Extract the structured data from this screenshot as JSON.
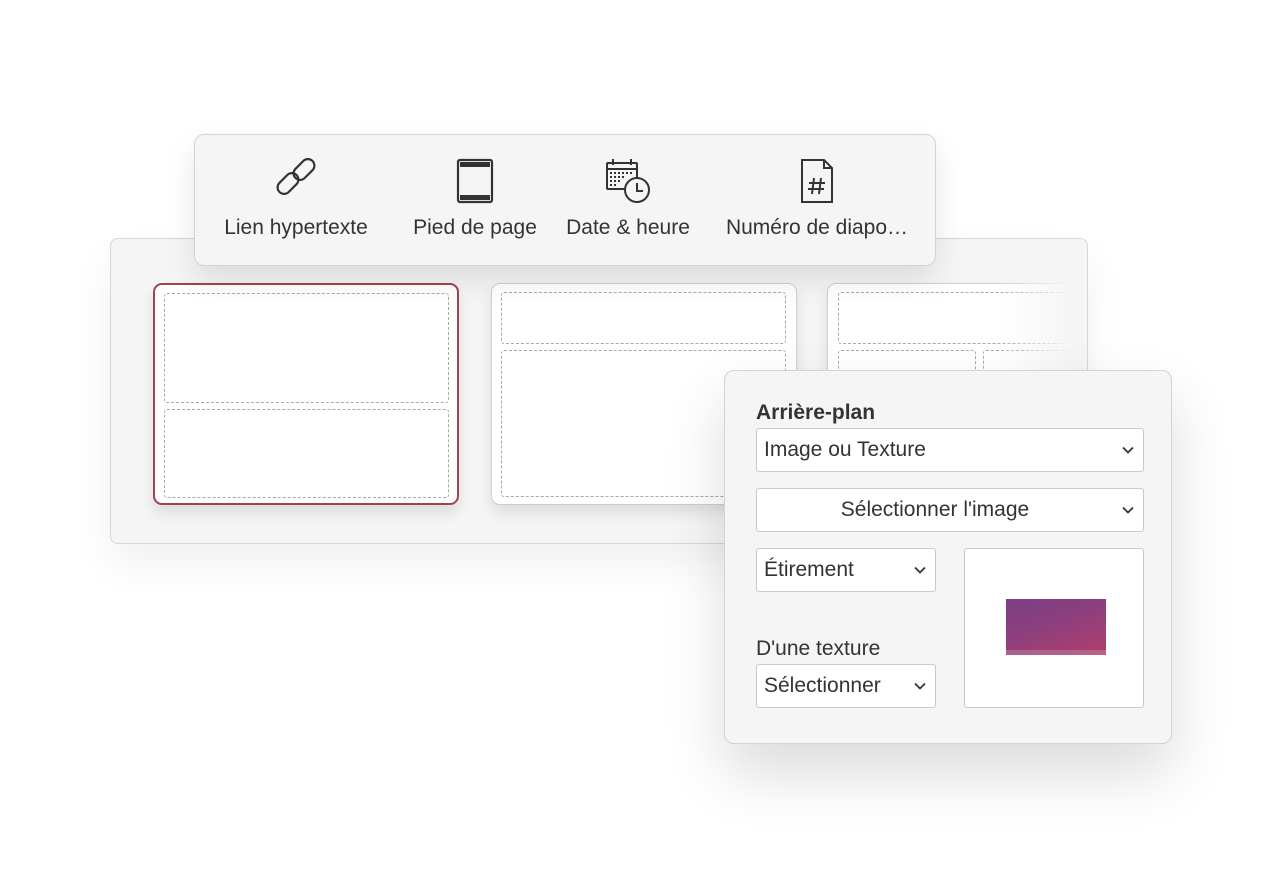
{
  "toolbar": {
    "items": [
      {
        "label": "Lien hypertexte",
        "icon": "link-icon"
      },
      {
        "label": "Pied de page",
        "icon": "footer-icon"
      },
      {
        "label": "Date & heure",
        "icon": "calendar-clock-icon"
      },
      {
        "label": "Numéro de diapo…",
        "icon": "slide-number-icon"
      }
    ]
  },
  "layouts": {
    "selected_index": 0,
    "accent_color": "#a3434f"
  },
  "background_panel": {
    "title": "Arrière-plan",
    "fill_type": "Image ou Texture",
    "select_image": "Sélectionner l'image",
    "fit_mode": "Étirement",
    "texture_label": "D'une texture",
    "texture_select": "Sélectionner"
  }
}
